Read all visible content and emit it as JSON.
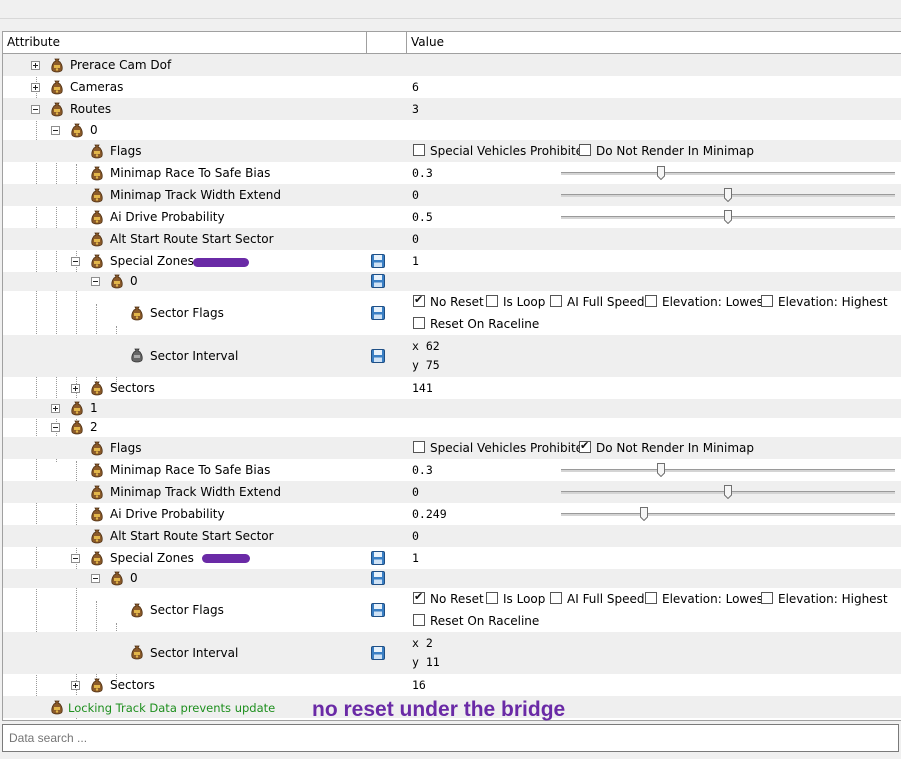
{
  "header": {
    "attribute": "Attribute",
    "value": "Value"
  },
  "tree": {
    "perace": "Prerace Cam Dof",
    "cameras": {
      "label": "Cameras",
      "value": "6"
    },
    "routes": {
      "label": "Routes",
      "value": "3"
    },
    "route0": {
      "label": "0",
      "flags": {
        "label": "Flags",
        "opt1": "Special Vehicles Prohibited",
        "opt2": "Do Not Render In Minimap"
      },
      "bias": {
        "label": "Minimap Race To Safe Bias",
        "value": "0.3",
        "slider": 0.3
      },
      "width": {
        "label": "Minimap Track Width Extend",
        "value": "0",
        "slider": 0.5
      },
      "ai": {
        "label": "Ai Drive Probability",
        "value": "0.5",
        "slider": 0.5
      },
      "alt": {
        "label": "Alt Start Route Start Sector",
        "value": "0"
      },
      "zones": {
        "label": "Special Zones",
        "value": "1"
      },
      "zone0": {
        "label": "0"
      },
      "sflags": {
        "label": "Sector Flags",
        "o1": "No Reset",
        "o2": "Is Loop",
        "o3": "AI Full Speed",
        "o4": "Elevation: Lowest",
        "o5": "Elevation: Highest",
        "o6": "Reset On Raceline"
      },
      "interval": {
        "label": "Sector Interval",
        "x": "x 62",
        "y": "y 75"
      },
      "sectors": {
        "label": "Sectors",
        "value": "141"
      }
    },
    "route1": {
      "label": "1"
    },
    "route2": {
      "label": "2",
      "flags": {
        "label": "Flags",
        "opt1": "Special Vehicles Prohibited",
        "opt2": "Do Not Render In Minimap"
      },
      "bias": {
        "label": "Minimap Race To Safe Bias",
        "value": "0.3",
        "slider": 0.3
      },
      "width": {
        "label": "Minimap Track Width Extend",
        "value": "0",
        "slider": 0.5
      },
      "ai": {
        "label": "Ai Drive Probability",
        "value": "0.249",
        "slider": 0.249
      },
      "alt": {
        "label": "Alt Start Route Start Sector",
        "value": "0"
      },
      "zones": {
        "label": "Special Zones",
        "value": "1"
      },
      "zone0": {
        "label": "0"
      },
      "sflags": {
        "label": "Sector Flags",
        "o1": "No Reset",
        "o2": "Is Loop",
        "o3": "AI Full Speed",
        "o4": "Elevation: Lowest",
        "o5": "Elevation: Highest",
        "o6": "Reset On Raceline"
      },
      "interval": {
        "label": "Sector Interval",
        "x": "x 2",
        "y": "y 11"
      },
      "sectors": {
        "label": "Sectors",
        "value": "16"
      }
    }
  },
  "status_text": "Locking Track Data prevents update",
  "annotation": "no reset under the bridge",
  "search": {
    "placeholder": "Data search ..."
  },
  "colors": {
    "annotation": "#6a2aa6",
    "status": "#1e8f1e"
  }
}
